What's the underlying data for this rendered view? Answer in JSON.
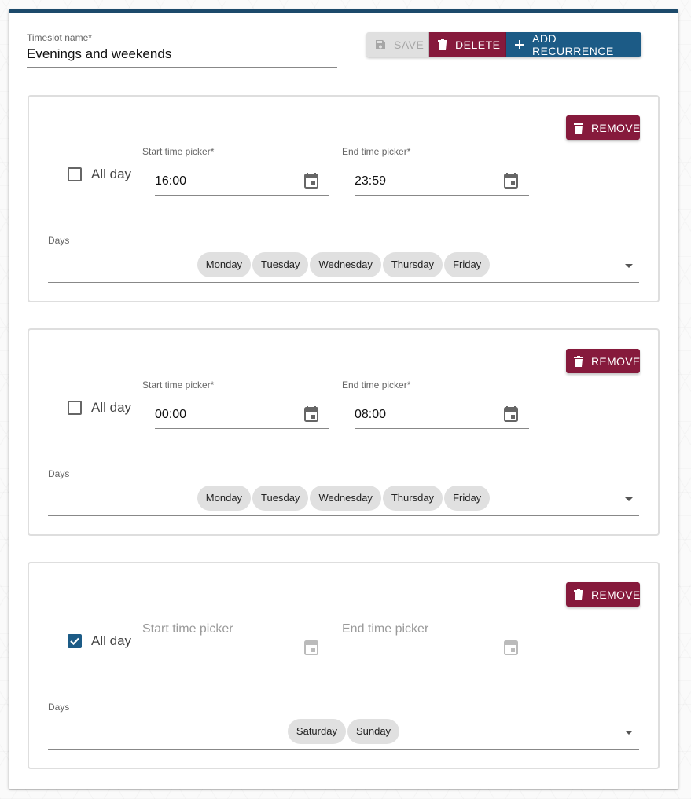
{
  "form": {
    "name_label": "Timeslot name",
    "required_mark": "*",
    "name_value": "Evenings and weekends"
  },
  "toolbar": {
    "save_label": "SAVE",
    "delete_label": "DELETE",
    "add_label": "ADD RECURRENCE"
  },
  "recurrences": [
    {
      "remove_label": "REMOVE",
      "allday_label": "All day",
      "allday_checked": false,
      "start_label": "Start time picker",
      "start_value": "16:00",
      "end_label": "End time picker",
      "end_value": "23:59",
      "days_label": "Days",
      "days": [
        "Monday",
        "Tuesday",
        "Wednesday",
        "Thursday",
        "Friday"
      ]
    },
    {
      "remove_label": "REMOVE",
      "allday_label": "All day",
      "allday_checked": false,
      "start_label": "Start time picker",
      "start_value": "00:00",
      "end_label": "End time picker",
      "end_value": "08:00",
      "days_label": "Days",
      "days": [
        "Monday",
        "Tuesday",
        "Wednesday",
        "Thursday",
        "Friday"
      ]
    },
    {
      "remove_label": "REMOVE",
      "allday_label": "All day",
      "allday_checked": true,
      "start_placeholder": "Start time picker",
      "end_placeholder": "End time picker",
      "days_label": "Days",
      "days": [
        "Saturday",
        "Sunday"
      ]
    }
  ],
  "colors": {
    "primary": "#1c5b86",
    "danger": "#861a3c",
    "header_bar": "#1c4a6b"
  }
}
